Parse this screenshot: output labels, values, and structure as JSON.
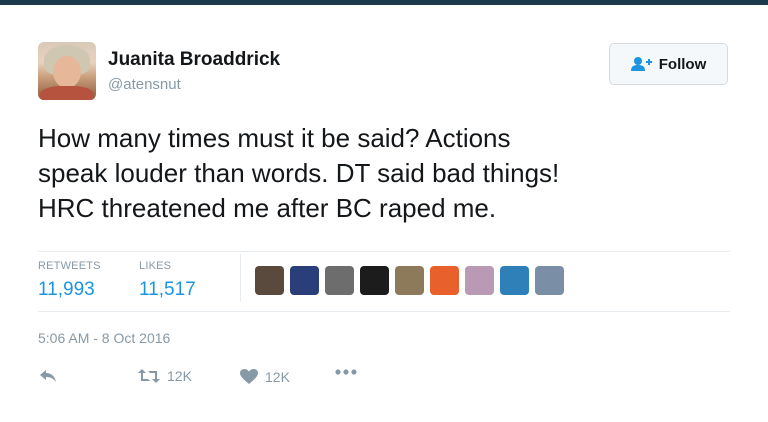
{
  "author": {
    "name": "Juanita Broaddrick",
    "handle": "@atensnut"
  },
  "follow_button": {
    "label": "Follow"
  },
  "tweet": {
    "lines": [
      "How many times must it be said? Actions",
      "speak louder than words. DT said bad things!",
      "HRC threatened me after BC raped me."
    ]
  },
  "stats": {
    "retweets_label": "RETWEETS",
    "retweets_value": "11,993",
    "likes_label": "LIKES",
    "likes_value": "11,517"
  },
  "liker_avatar_colors": [
    "#5a4a3e",
    "#2a3f7a",
    "#6d6d6d",
    "#1c1c1c",
    "#8c7a5b",
    "#e8602c",
    "#b89ab5",
    "#2f7fb8",
    "#7a8fa6"
  ],
  "timestamp": "5:06 AM - 8 Oct 2016",
  "actions": {
    "retweet_count": "12K",
    "like_count": "12K"
  },
  "colors": {
    "link_blue": "#1b95e0",
    "muted_gray": "#8899a6",
    "text": "#14171a"
  }
}
